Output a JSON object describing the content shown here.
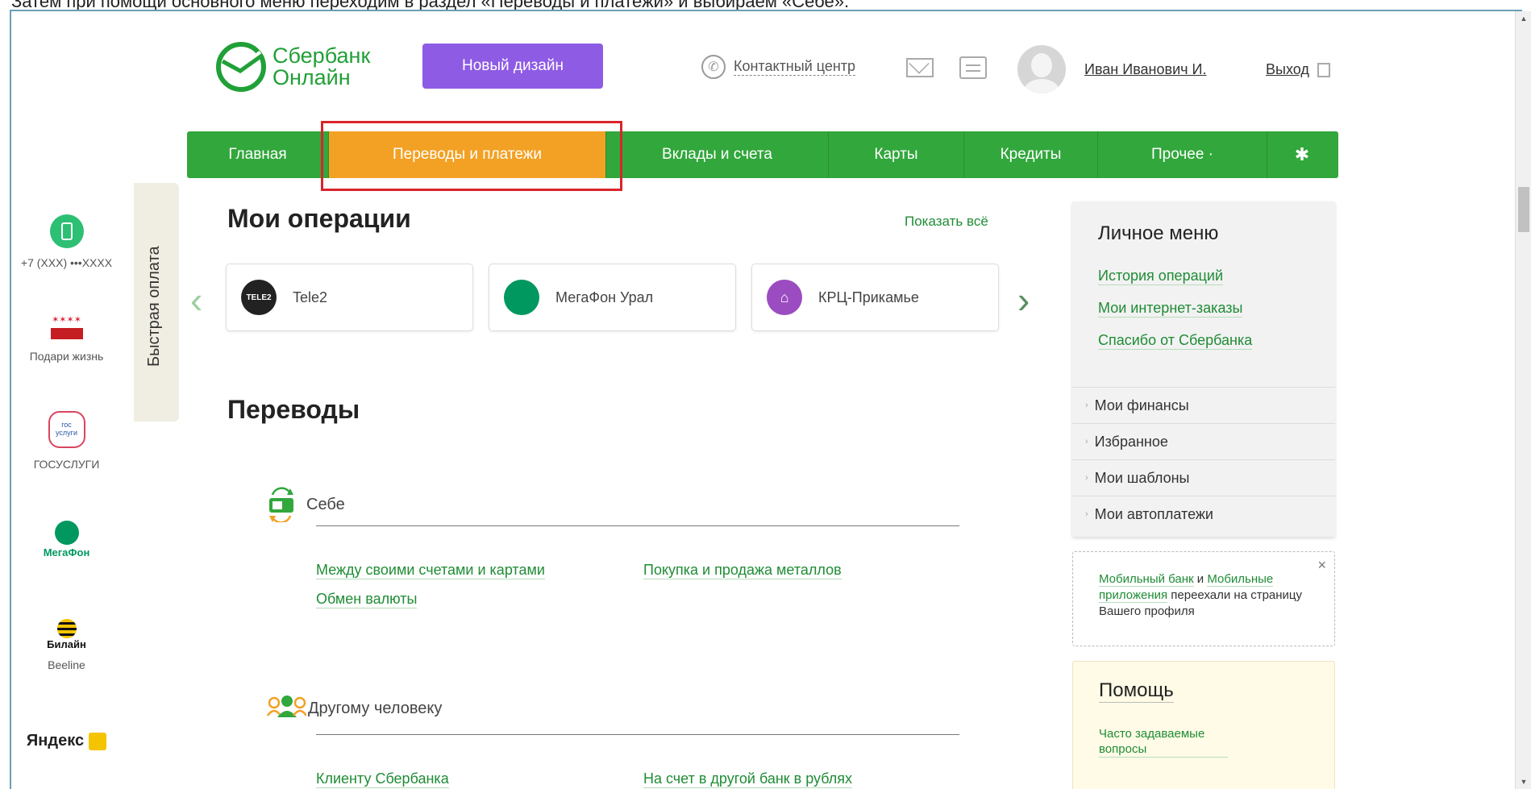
{
  "top_strip": {
    "text": "Затем при помощи основного меню переходим в раздел «Переводы и платежи» и выбираем «Себе»."
  },
  "header": {
    "logo_line1": "Сбербанк",
    "logo_line2": "Онлайн",
    "new_design_label": "Новый дизайн",
    "contact_center": "Контактный центр",
    "user_name": "Иван Иванович И.",
    "logout": "Выход"
  },
  "nav": {
    "items": [
      {
        "label": "Главная"
      },
      {
        "label": "Переводы и платежи",
        "active": true
      },
      {
        "label": "Вклады и счета"
      },
      {
        "label": "Карты"
      },
      {
        "label": "Кредиты"
      },
      {
        "label": "Прочее ·"
      }
    ],
    "settings_icon": "gear-icon"
  },
  "quick_pay": {
    "tab_label": "Быстрая оплата",
    "items": [
      {
        "label": "+7 (XXX) •••XXXX",
        "icon": "phone-icon"
      },
      {
        "label": "Подари жизнь",
        "icon": "podari-zhizn-logo"
      },
      {
        "label": "ГОСУСЛУГИ",
        "icon": "gosuslugi-logo",
        "logo_text": "гос услуги"
      },
      {
        "label": "",
        "icon": "megafon-logo",
        "logo_text": "МегаФон"
      },
      {
        "label": "Beeline",
        "icon": "beeline-logo",
        "logo_text": "Билайн"
      },
      {
        "label": "",
        "icon": "yandex-logo",
        "logo_text": "Яндекс"
      }
    ]
  },
  "operations": {
    "title": "Мои операции",
    "show_all": "Показать всё",
    "cards": [
      {
        "label": "Tele2",
        "logo_text": "TELE2",
        "color": "#222222"
      },
      {
        "label": "МегаФон Урал",
        "color": "#00985f"
      },
      {
        "label": "КРЦ-Прикамье",
        "color": "#9b4cc0"
      }
    ]
  },
  "transfers": {
    "title": "Переводы",
    "self": {
      "label": "Себе",
      "links": [
        "Между своими счетами и картами",
        "Покупка и продажа металлов",
        "Обмен валюты"
      ]
    },
    "other": {
      "label": "Другому человеку",
      "links": [
        "Клиенту Сбербанка",
        "На счет в другой банк в рублях"
      ]
    }
  },
  "personal_menu": {
    "title": "Личное меню",
    "links": [
      "История операций",
      "Мои интернет-заказы",
      "Спасибо от Сбербанка"
    ],
    "rows": [
      "Мои финансы",
      "Избранное",
      "Мои шаблоны",
      "Мои автоплатежи"
    ]
  },
  "info": {
    "link1": "Мобильный банк",
    "and": " и ",
    "link2a": "Мобильные",
    "link2b": "приложения",
    "text": " переехали на страницу Вашего профиля",
    "close": "×"
  },
  "help": {
    "title": "Помощь",
    "faq": "Часто задаваемые вопросы"
  },
  "colors": {
    "brand_green": "#32a73c",
    "active_orange": "#f2a124",
    "purple_button": "#8e5be4",
    "highlight_red": "#d9252a"
  }
}
